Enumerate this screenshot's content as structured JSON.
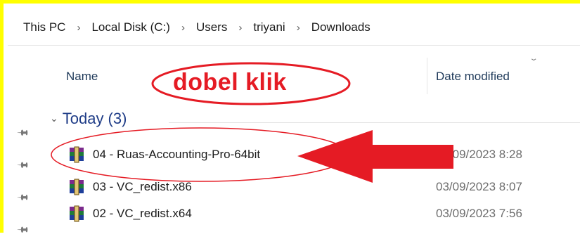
{
  "breadcrumb": [
    "This PC",
    "Local Disk (C:)",
    "Users",
    "triyani",
    "Downloads"
  ],
  "breadcrumb_separator": "›",
  "columns": {
    "name": "Name",
    "date_modified": "Date modified"
  },
  "group": {
    "label": "Today (3)"
  },
  "files": [
    {
      "name": "04 - Ruas-Accounting-Pro-64bit",
      "date": "03/09/2023 8:28",
      "icon": "winrar-archive-icon"
    },
    {
      "name": "03 - VC_redist.x86",
      "date": "03/09/2023 8:07",
      "icon": "winrar-archive-icon"
    },
    {
      "name": "02 - VC_redist.x64",
      "date": "03/09/2023 7:56",
      "icon": "winrar-archive-icon"
    }
  ],
  "annotation": {
    "text": "dobel klik",
    "color": "#e51b24"
  },
  "colors": {
    "frame": "#ffff00",
    "header_text": "#1e3959",
    "group_text": "#1e3c87",
    "annotation": "#e51b24"
  }
}
